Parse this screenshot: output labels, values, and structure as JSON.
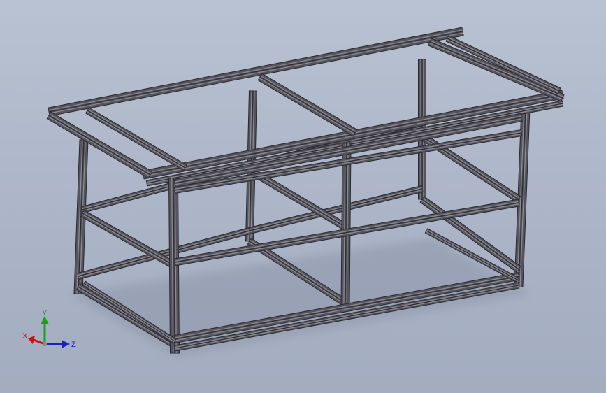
{
  "viewport": {
    "background_top": "#b9c2d2",
    "background_bottom": "#a3acc0"
  },
  "model": {
    "name": "aluminium-extrusion-frame",
    "frame_color": "#55545c",
    "frame_dark": "#2a2a30",
    "frame_light": "#8c8b94"
  },
  "triad": {
    "x_label": "X",
    "y_label": "Y",
    "z_label": "Z",
    "x_color": "#cc1010",
    "y_color": "#18a018",
    "z_color": "#1820c8"
  }
}
